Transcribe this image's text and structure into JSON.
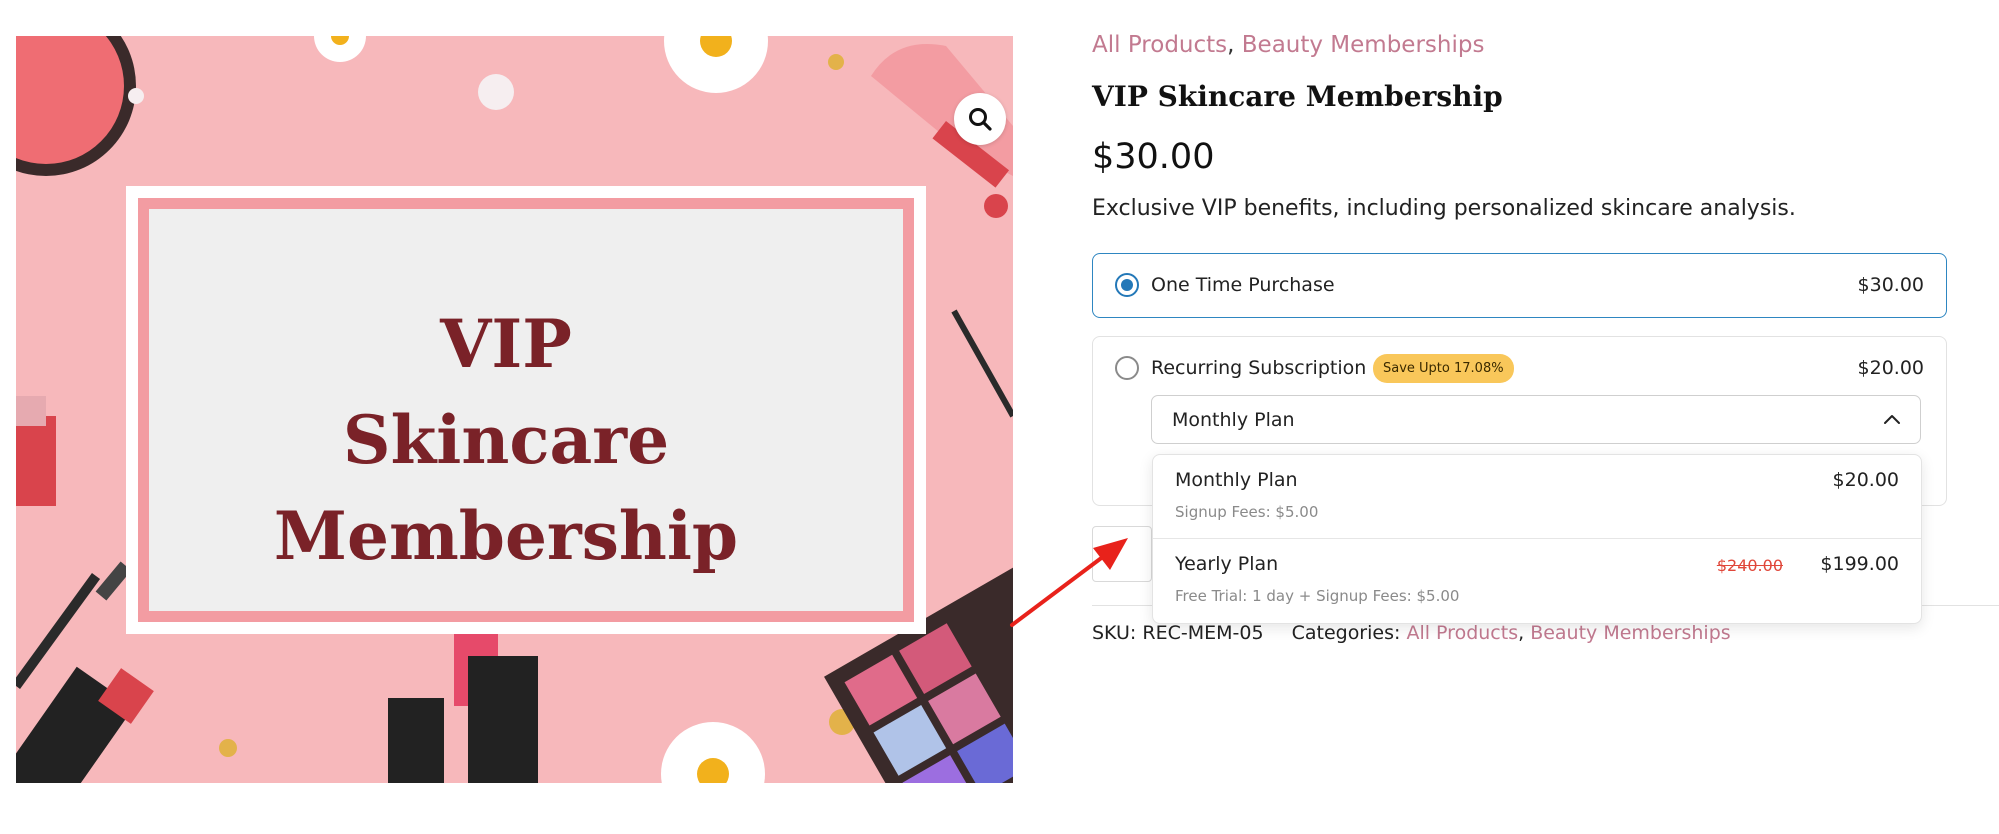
{
  "image": {
    "card_line1": "VIP",
    "card_line2": "Skincare",
    "card_line3": "Membership",
    "zoom_icon": "search-icon",
    "background_color": "#f7b8bb"
  },
  "breadcrumbs": {
    "cat1": "All Products",
    "sep": ",",
    "cat2": "Beauty Memberships"
  },
  "product": {
    "title": "VIP Skincare Membership",
    "price": "$30.00",
    "description": "Exclusive VIP benefits, including personalized skincare analysis."
  },
  "options": {
    "one_time": {
      "label": "One Time Purchase",
      "price": "$30.00",
      "selected": true
    },
    "recurring": {
      "label": "Recurring Subscription",
      "badge": "Save Upto 17.08%",
      "price": "$20.00",
      "selected": false,
      "select_value": "Monthly Plan"
    }
  },
  "dropdown": {
    "items": [
      {
        "name": "Monthly Plan",
        "sub": "Signup Fees: $5.00",
        "price": "$20.00",
        "old_price": ""
      },
      {
        "name": "Yearly Plan",
        "sub": "Free Trial: 1 day + Signup Fees: $5.00",
        "price": "$199.00",
        "old_price": "$240.00"
      }
    ]
  },
  "meta": {
    "sku_label": "SKU:",
    "sku_value": "REC-MEM-05",
    "categories_label": "Categories:",
    "cat1": "All Products",
    "cat2": "Beauty Memberships"
  },
  "colors": {
    "accent": "#2378b8",
    "link": "#c27a90",
    "badge": "#f9c75a",
    "strike": "#e0473a",
    "arrow": "#e8221b"
  }
}
